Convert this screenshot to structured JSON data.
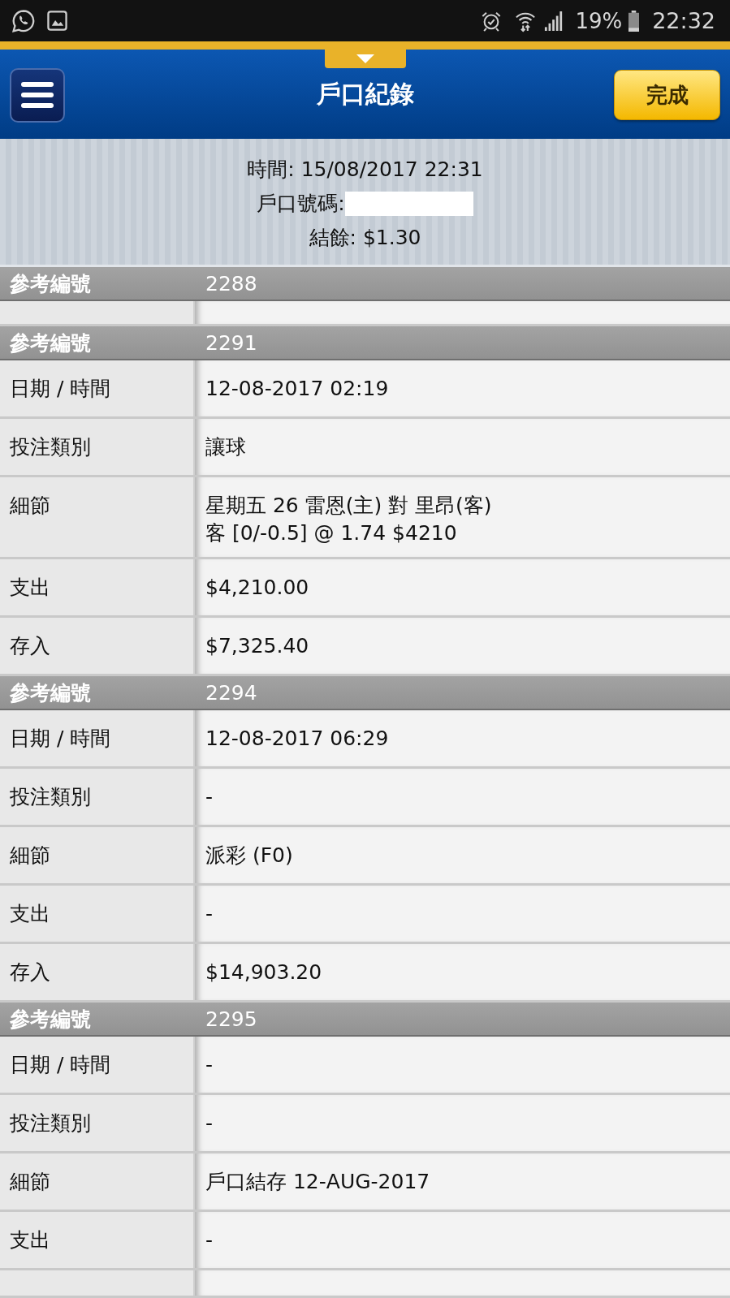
{
  "status_bar": {
    "battery": "19%",
    "time": "22:32"
  },
  "header": {
    "title": "戶口紀錄",
    "done_button": "完成"
  },
  "summary": {
    "time": "時間: 15/08/2017 22:31",
    "account": "戶口號碼:",
    "account_redacted": true,
    "balance": "結餘: $1.30"
  },
  "records": [
    {
      "ref_label": "參考編號",
      "ref": "2288",
      "fields": [
        {
          "kind": "cut"
        }
      ]
    },
    {
      "ref_label": "參考編號",
      "ref": "2291",
      "fields": [
        {
          "kind": "field",
          "label": "日期 / 時間",
          "value": "12-08-2017 02:19"
        },
        {
          "kind": "field",
          "label": "投注類別",
          "value": "讓球"
        },
        {
          "kind": "field",
          "label": "細節",
          "value": "星期五 26 雷恩(主) 對 里昂(客)\n客 [0/-0.5] @ 1.74 $4210"
        },
        {
          "kind": "field",
          "label": "支出",
          "value": "$4,210.00"
        },
        {
          "kind": "field",
          "label": "存入",
          "value": "$7,325.40"
        }
      ]
    },
    {
      "ref_label": "參考編號",
      "ref": "2294",
      "fields": [
        {
          "kind": "field",
          "label": "日期 / 時間",
          "value": "12-08-2017 06:29"
        },
        {
          "kind": "field",
          "label": "投注類別",
          "value": "-"
        },
        {
          "kind": "field",
          "label": "細節",
          "value": "派彩 (F0)"
        },
        {
          "kind": "field",
          "label": "支出",
          "value": "-"
        },
        {
          "kind": "field",
          "label": "存入",
          "value": "$14,903.20"
        }
      ]
    },
    {
      "ref_label": "參考編號",
      "ref": "2295",
      "fields": [
        {
          "kind": "field",
          "label": "日期 / 時間",
          "value": "-"
        },
        {
          "kind": "field",
          "label": "投注類別",
          "value": "-"
        },
        {
          "kind": "field",
          "label": "細節",
          "value": "戶口結存 12-AUG-2017"
        },
        {
          "kind": "field",
          "label": "支出",
          "value": "-"
        },
        {
          "kind": "cut"
        }
      ]
    }
  ]
}
